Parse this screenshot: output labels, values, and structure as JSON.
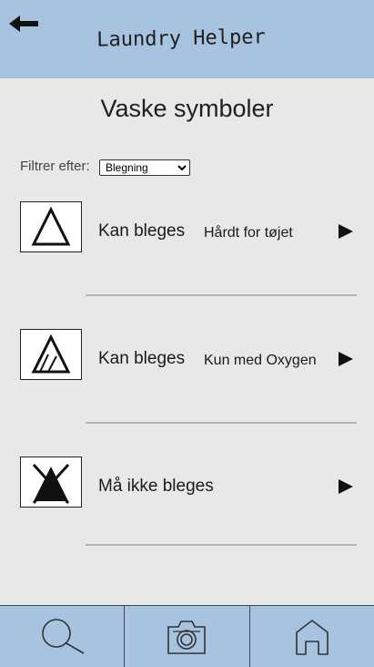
{
  "header": {
    "back_icon": "arrow-left-icon",
    "title": "Laundry Helper"
  },
  "page": {
    "title": "Vaske symboler"
  },
  "filter": {
    "label": "Filtrer efter:",
    "selected": "Blegning",
    "options": [
      "Blegning"
    ]
  },
  "symbols": [
    {
      "icon": "bleach-triangle-icon",
      "label": "Kan bleges",
      "note": "Hårdt for tøjet"
    },
    {
      "icon": "oxygen-bleach-triangle-icon",
      "label": "Kan bleges",
      "note": "Kun med Oxygen"
    },
    {
      "icon": "no-bleach-icon",
      "label": "Må ikke bleges",
      "note": ""
    }
  ],
  "bottom_nav": {
    "items": [
      {
        "icon": "search-icon"
      },
      {
        "icon": "camera-icon"
      },
      {
        "icon": "home-icon"
      }
    ],
    "background": "#a8c3e0"
  }
}
